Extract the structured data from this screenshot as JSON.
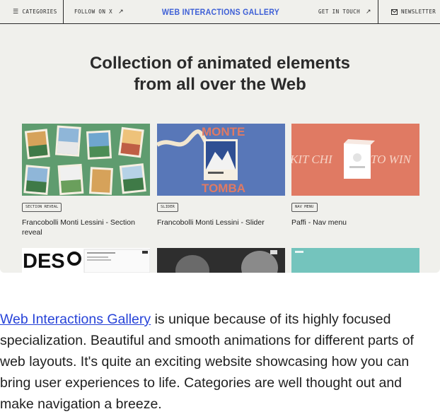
{
  "screenshot": {
    "topbar": {
      "categories_label": "CATEGORIES",
      "follow_label": "FOLLOW ON X",
      "site_title": "WEB INTERACTIONS GALLERY",
      "contact_label": "GET IN TOUCH",
      "newsletter_label": "NEWSLETTER",
      "icons": {
        "categories": "list-icon",
        "follow": "arrow-up-right-icon",
        "contact": "arrow-up-right-icon",
        "newsletter": "mail-icon"
      }
    },
    "hero": {
      "line1": "Collection of animated elements",
      "line2": "from all over the Web"
    },
    "cards": [
      {
        "tag": "SECTION REVEAL",
        "title": "Francobolli Monti Lessini - Section reveal",
        "thumb_color": "#5f9c6f"
      },
      {
        "tag": "SLIDER",
        "title": "Francobolli Monti Lessini - Slider",
        "thumb_color": "#5877b8"
      },
      {
        "tag": "NAV MENU",
        "title": "Paffi - Nav menu",
        "thumb_color": "#e07a63"
      }
    ],
    "thumb_text": {
      "monte": "MONTE",
      "tomba": "TOMBA",
      "kit": "KIT CHI",
      "towin": "TO WIN",
      "des": "DES"
    },
    "brand_color": "#3d5fd6"
  },
  "paragraph": {
    "link_text": "Web Interactions Gallery",
    "body_text": " is unique because of its highly focused specialization. Beautiful and smooth animations for different parts of web layouts. It's quite an exciting website showcasing how you can bring user experiences to life. Categories are well thought out and make navigation a breeze.",
    "link_color": "#2743d8"
  }
}
